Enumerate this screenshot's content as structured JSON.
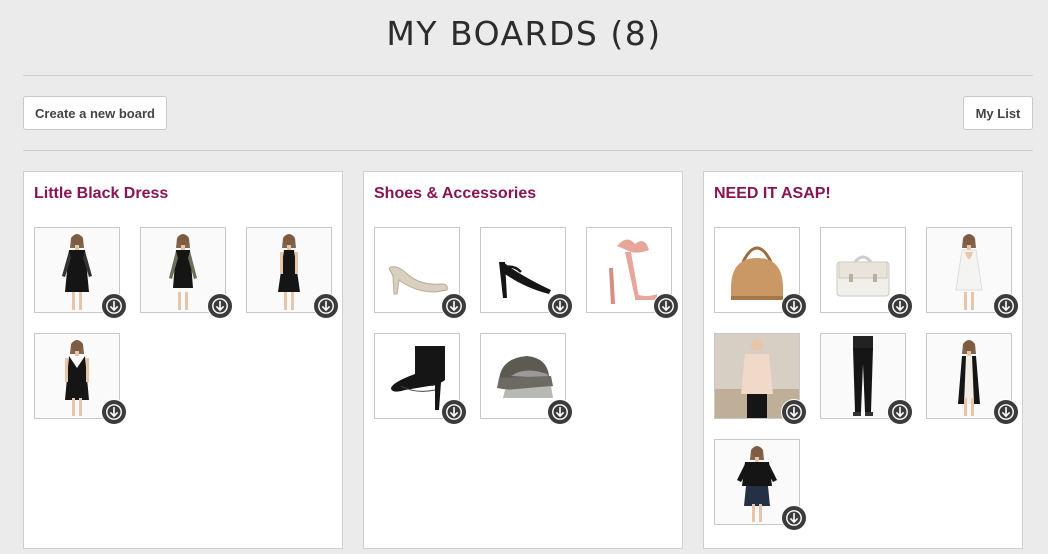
{
  "page": {
    "title": "MY BOARDS (8)"
  },
  "toolbar": {
    "create_label": "Create a new board",
    "mylist_label": "My List"
  },
  "colors": {
    "background": "#ebebeb",
    "board_title": "#8a1452",
    "download_badge": "#3b3b3b"
  },
  "boards": [
    {
      "title": "Little Black Dress",
      "items": [
        {
          "icon": "dress-icon",
          "kind": "dress-lace-sleeve"
        },
        {
          "icon": "dress-icon",
          "kind": "dress-long-sleeve"
        },
        {
          "icon": "dress-icon",
          "kind": "dress-halter"
        },
        {
          "icon": "dress-icon",
          "kind": "dress-vneck"
        }
      ]
    },
    {
      "title": "Shoes & Accessories",
      "items": [
        {
          "icon": "shoe-icon",
          "kind": "pump-nude"
        },
        {
          "icon": "shoe-icon",
          "kind": "heel-black-strap"
        },
        {
          "icon": "shoe-icon",
          "kind": "heel-pink-bow"
        },
        {
          "icon": "shoe-icon",
          "kind": "boot-black"
        },
        {
          "icon": "cap-icon",
          "kind": "cap-studded"
        }
      ]
    },
    {
      "title": "NEED IT ASAP!",
      "items": [
        {
          "icon": "bag-icon",
          "kind": "bag-tan"
        },
        {
          "icon": "bag-icon",
          "kind": "satchel-white"
        },
        {
          "icon": "dress-icon",
          "kind": "dress-white-open-back"
        },
        {
          "icon": "shirt-icon",
          "kind": "blouse-nude"
        },
        {
          "icon": "jeans-icon",
          "kind": "jeans-black"
        },
        {
          "icon": "dress-icon",
          "kind": "dress-lace-panel"
        },
        {
          "icon": "shirt-icon",
          "kind": "shirt-black-skirt"
        }
      ]
    }
  ]
}
